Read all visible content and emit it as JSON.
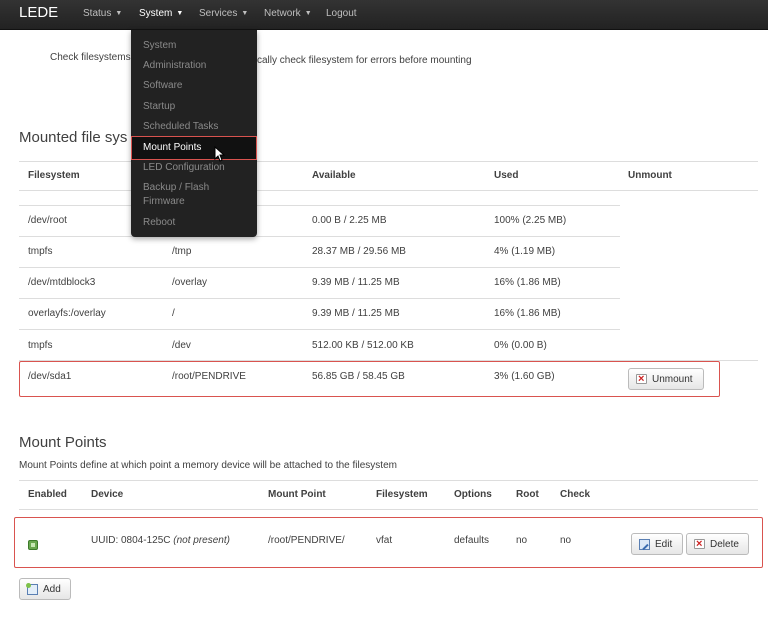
{
  "navbar": {
    "brand": "LEDE",
    "items": [
      "Status",
      "System",
      "Services",
      "Network",
      "Logout"
    ]
  },
  "dropdown": {
    "items": [
      "System",
      "Administration",
      "Software",
      "Startup",
      "Scheduled Tasks",
      "Mount Points",
      "LED Configuration",
      "Backup / Flash",
      "Firmware",
      "Reboot"
    ],
    "selected": "Mount Points"
  },
  "general": {
    "check_label": "Check filesystems",
    "check_desc": "cally check filesystem for errors before mounting"
  },
  "mounted": {
    "title": "Mounted file sys",
    "columns": [
      "Filesystem",
      "Available",
      "Used",
      "Unmount"
    ],
    "rows": [
      {
        "fs": "/dev/root",
        "mount": "",
        "avail": "0.00 B / 2.25 MB",
        "used": "100% (2.25 MB)"
      },
      {
        "fs": "tmpfs",
        "mount": "/tmp",
        "avail": "28.37 MB / 29.56 MB",
        "used": "4% (1.19 MB)"
      },
      {
        "fs": "/dev/mtdblock3",
        "mount": "/overlay",
        "avail": "9.39 MB / 11.25 MB",
        "used": "16% (1.86 MB)"
      },
      {
        "fs": "overlayfs:/overlay",
        "mount": "/",
        "avail": "9.39 MB / 11.25 MB",
        "used": "16% (1.86 MB)"
      },
      {
        "fs": "tmpfs",
        "mount": "/dev",
        "avail": "512.00 KB / 512.00 KB",
        "used": "0% (0.00 B)"
      },
      {
        "fs": "/dev/sda1",
        "mount": "/root/PENDRIVE",
        "avail": "56.85 GB / 58.45 GB",
        "used": "3% (1.60 GB)"
      }
    ],
    "unmount_label": "Unmount"
  },
  "mountpoints": {
    "title": "Mount Points",
    "desc": "Mount Points define at which point a memory device will be attached to the filesystem",
    "columns": [
      "Enabled",
      "Device",
      "Mount Point",
      "Filesystem",
      "Options",
      "Root",
      "Check"
    ],
    "row": {
      "device": "UUID: 0804-125C",
      "device_note": "(not present)",
      "mount": "/root/PENDRIVE/",
      "fs": "vfat",
      "options": "defaults",
      "root": "no",
      "check": "no"
    },
    "edit_label": "Edit",
    "delete_label": "Delete",
    "add_label": "Add"
  }
}
